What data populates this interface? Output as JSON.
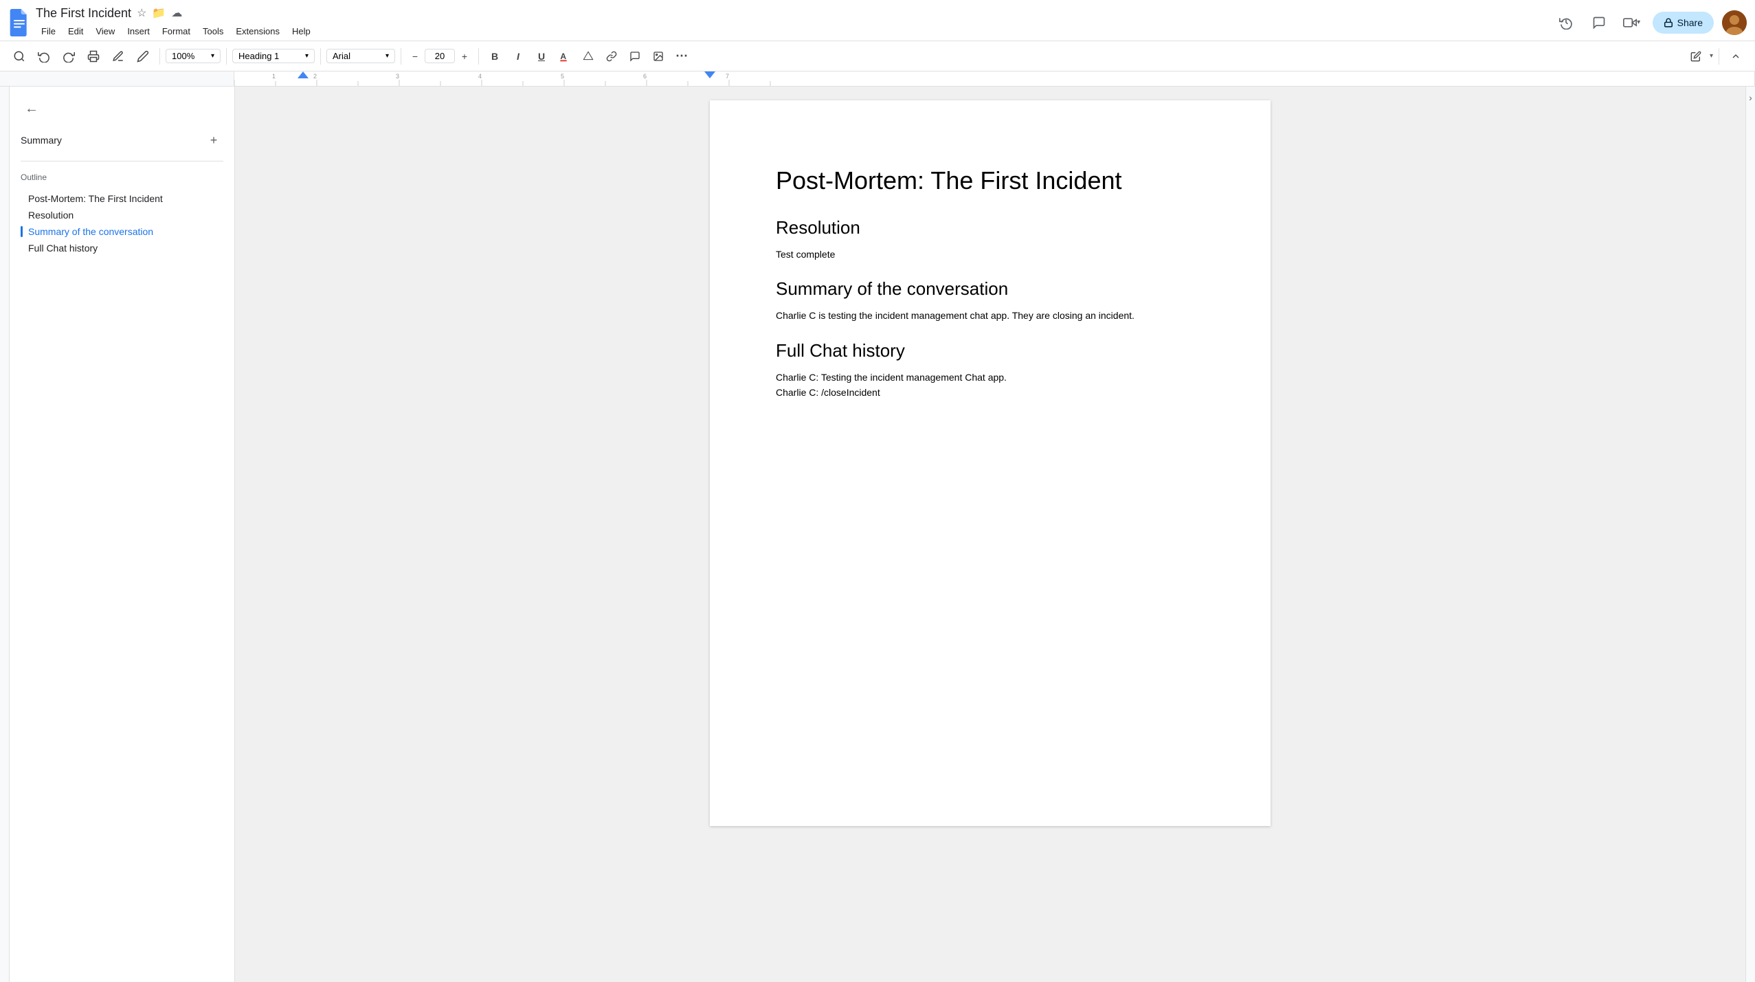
{
  "titlebar": {
    "doc_title": "The First Incident",
    "menu_items": [
      "File",
      "Edit",
      "View",
      "Insert",
      "Format",
      "Tools",
      "Extensions",
      "Help"
    ],
    "share_label": "Share",
    "zoom": "100%"
  },
  "toolbar": {
    "style_selector": "Heading 1",
    "font_selector": "Arial",
    "font_size": "20",
    "bold_label": "B",
    "italic_label": "I",
    "underline_label": "U"
  },
  "sidebar": {
    "summary_label": "Summary",
    "outline_label": "Outline",
    "outline_items": [
      {
        "id": "item1",
        "label": "Post-Mortem: The First Incident",
        "active": false
      },
      {
        "id": "item2",
        "label": "Resolution",
        "active": false
      },
      {
        "id": "item3",
        "label": "Summary of the conversation",
        "active": true
      },
      {
        "id": "item4",
        "label": "Full Chat history",
        "active": false
      }
    ]
  },
  "document": {
    "title": "Post-Mortem: The First Incident",
    "sections": [
      {
        "heading": "Resolution",
        "body": "Test complete"
      },
      {
        "heading": "Summary of the conversation",
        "body": "Charlie C is testing the incident management chat app. They are closing an incident."
      },
      {
        "heading": "Full Chat history",
        "lines": [
          "Charlie C: Testing the incident management Chat app.",
          "Charlie C: /closeIncident"
        ]
      }
    ]
  }
}
